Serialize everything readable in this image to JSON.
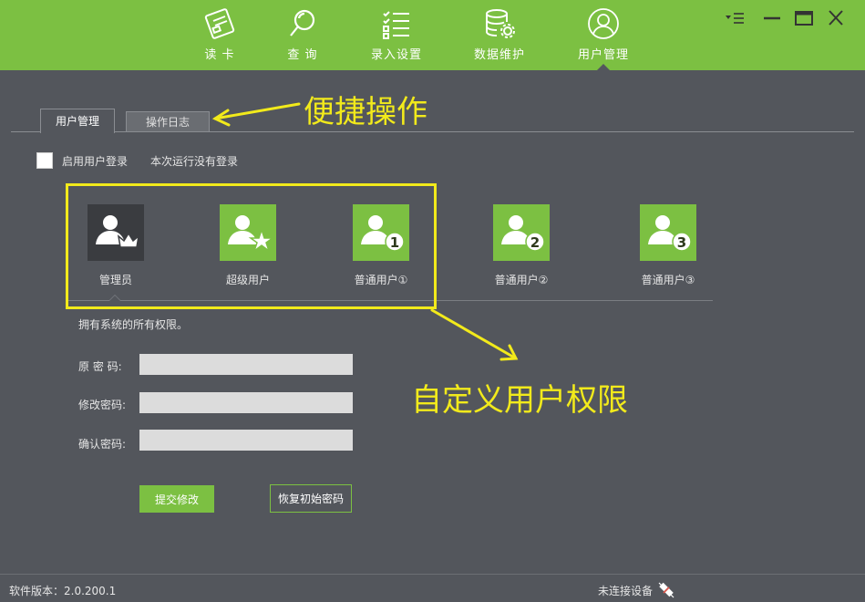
{
  "nav": {
    "items": [
      {
        "label": "读 卡",
        "icon": "card-reader-icon"
      },
      {
        "label": "查 询",
        "icon": "search-icon"
      },
      {
        "label": "录入设置",
        "icon": "list-settings-icon"
      },
      {
        "label": "数据维护",
        "icon": "database-gear-icon"
      },
      {
        "label": "用户管理",
        "icon": "user-icon"
      }
    ],
    "active": "用户管理"
  },
  "tabs": [
    {
      "label": "用户管理"
    },
    {
      "label": "操作日志"
    }
  ],
  "login": {
    "checkbox_label": "启用用户登录",
    "status": "本次运行没有登录"
  },
  "roles": [
    {
      "label": "管理员",
      "badge": "crown"
    },
    {
      "label": "超级用户",
      "badge": "star"
    },
    {
      "label": "普通用户①",
      "badge": "1"
    },
    {
      "label": "普通用户②",
      "badge": "2"
    },
    {
      "label": "普通用户③",
      "badge": "3"
    }
  ],
  "role_description": "拥有系统的所有权限。",
  "form": {
    "old_password_label": "原 密 码:",
    "new_password_label": "修改密码:",
    "confirm_password_label": "确认密码:",
    "old_password_value": "",
    "new_password_value": "",
    "confirm_password_value": "",
    "submit_label": "提交修改",
    "reset_label": "恢复初始密码"
  },
  "annotations": {
    "shortcut": "便捷操作",
    "custom_permissions": "自定义用户权限"
  },
  "status": {
    "version": "软件版本：2.0.200.1",
    "device": "未连接设备"
  },
  "colors": {
    "accent": "#7cc042",
    "background": "#53565c",
    "annotation": "#f2ea1b"
  }
}
